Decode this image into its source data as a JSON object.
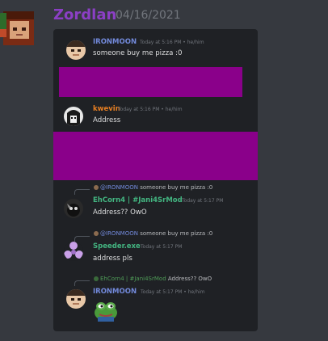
{
  "header": {
    "username": "Zordlan",
    "date": "04/16/2021",
    "username_color": "#8b3fc4"
  },
  "messages": [
    {
      "username": "IRONMOON",
      "meta": "Today at 5:16 PM • he/him",
      "text": "someone buy me pizza :0",
      "color": "#7289da"
    },
    {
      "username": "kwevin",
      "meta": "Today at 5:16 PM • he/him",
      "text": "Address",
      "color": "#e67e22"
    },
    {
      "reply": {
        "mention": "@IRONMOON",
        "text": "someone buy me pizza :0"
      },
      "username": "EhCorn4 | #Jani4SrMod",
      "meta": "Today at 5:17 PM",
      "text": "Address?? OwO",
      "color": "#43b581"
    },
    {
      "reply": {
        "mention": "@IRONMOON",
        "text": "someone buy me pizza :0"
      },
      "username": "Speeder.exe",
      "meta": "Today at 5:17 PM",
      "text": "address pls",
      "color": "#43b581"
    },
    {
      "reply": {
        "user": "EhCorn4",
        "mention": "#Jani4SrMod",
        "text": "Address?? OwO"
      },
      "username": "IRONMOON",
      "meta": "Today at 5:17 PM • he/him",
      "sticker": "pepe-frog",
      "color": "#7289da"
    }
  ],
  "redaction_color": "#8a008a"
}
